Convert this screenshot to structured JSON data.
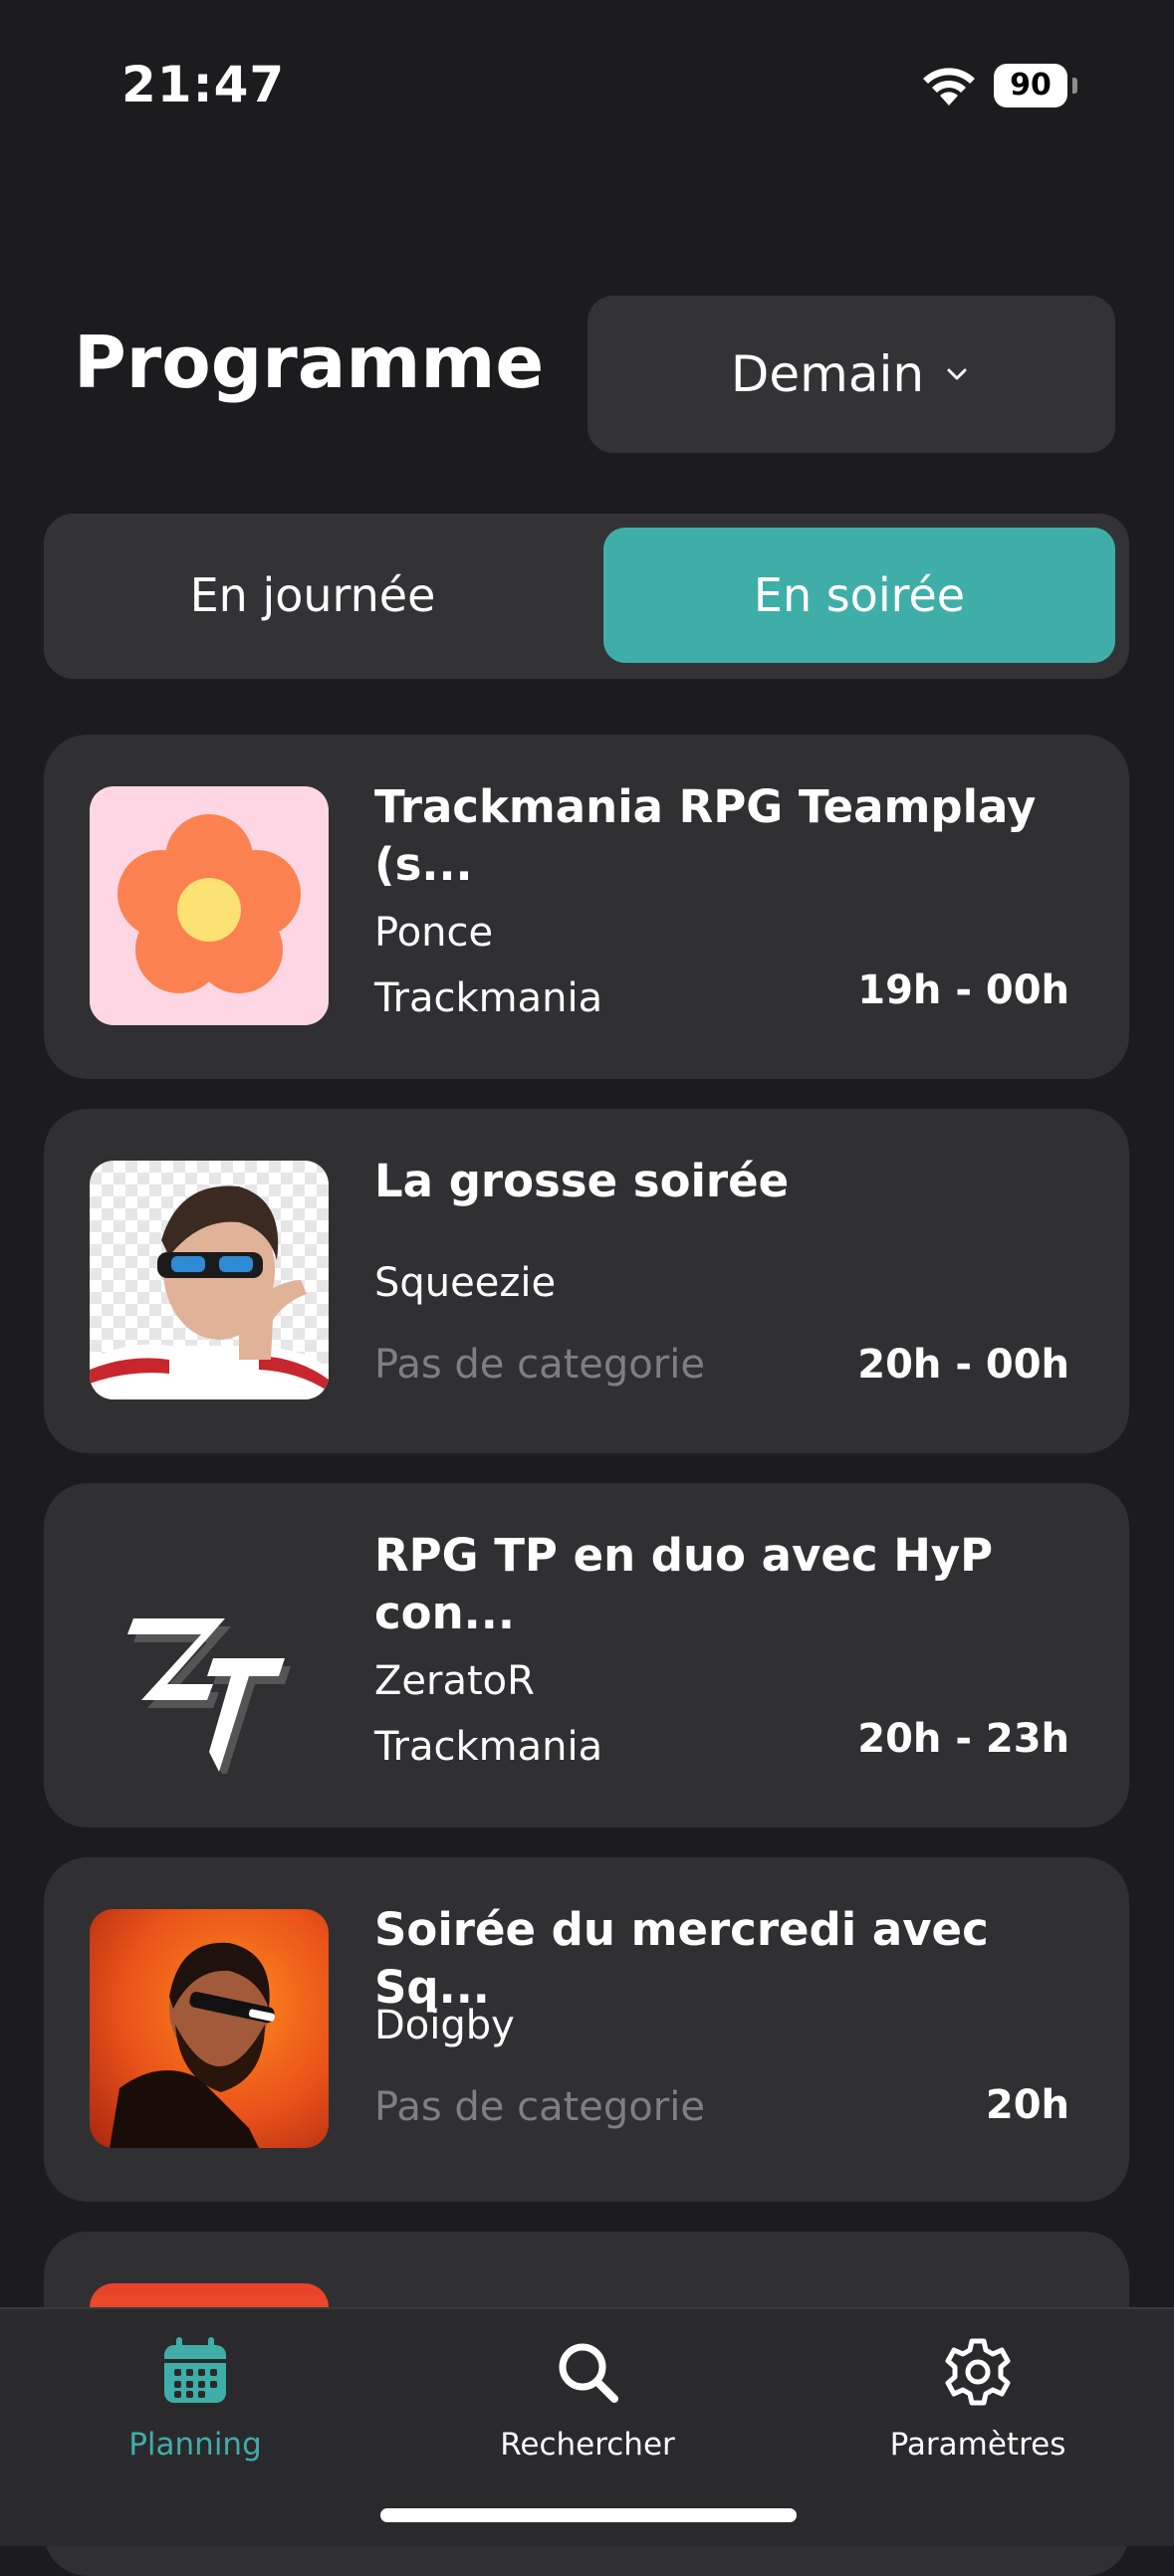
{
  "status_bar": {
    "time": "21:47",
    "battery": "90"
  },
  "header": {
    "title": "Programme",
    "day_selector": "Demain"
  },
  "segments": {
    "day": "En journée",
    "night": "En soirée",
    "active": "En soirée"
  },
  "programs": [
    {
      "title": "Trackmania RPG Teamplay (s...",
      "streamer": "Ponce",
      "category": "Trackmania",
      "time": "19h - 00h",
      "thumb": "flower"
    },
    {
      "title": "La grosse soirée",
      "streamer": "Squeezie",
      "category": "Pas de categorie",
      "time": "20h - 00h",
      "thumb": "squeezie"
    },
    {
      "title": "RPG TP en duo avec HyP con...",
      "streamer": "ZeratoR",
      "category": "Trackmania",
      "time": "20h - 23h",
      "thumb": "zeratorr-logo"
    },
    {
      "title": "Soirée du mercredi avec Sq...",
      "streamer": "Doigby",
      "category": "Pas de categorie",
      "time": "20h",
      "thumb": "doigby"
    }
  ],
  "tabs": [
    {
      "label": "Planning",
      "icon": "calendar-icon",
      "active": true
    },
    {
      "label": "Rechercher",
      "icon": "search-icon",
      "active": false
    },
    {
      "label": "Paramètres",
      "icon": "gear-icon",
      "active": false
    }
  ],
  "colors": {
    "accent": "#40aea8",
    "background": "#1c1c1e",
    "card": "#303032"
  }
}
